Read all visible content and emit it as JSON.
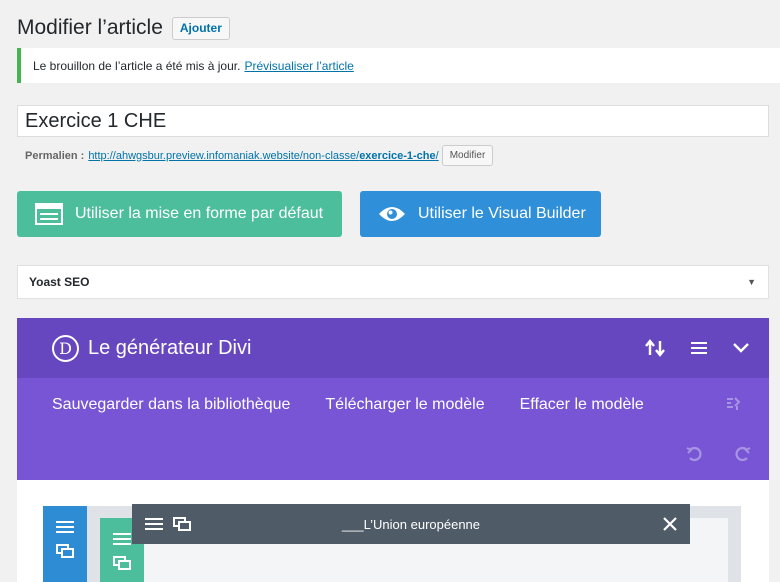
{
  "header": {
    "title": "Modifier l’article",
    "add_button": "Ajouter"
  },
  "notice": {
    "text": "Le brouillon de l’article a été mis à jour.",
    "link": "Prévisualiser l’article"
  },
  "post": {
    "title": "Exercice 1 CHE"
  },
  "permalink": {
    "label": "Permalien :",
    "url_prefix": "http://ahwgsbur.preview.infomaniak.website/non-classe/",
    "slug": "exercice-1-che",
    "url_suffix": "/",
    "edit_button": "Modifier"
  },
  "buttons": {
    "default_layout": "Utiliser la mise en forme par défaut",
    "visual_builder": "Utiliser le Visual Builder"
  },
  "yoast": {
    "title": "Yoast SEO"
  },
  "divi": {
    "logo": "D",
    "title": "Le générateur Divi",
    "actions": [
      "Sauvegarder dans la bibliothèque",
      "Télécharger le modèle",
      "Effacer le modèle"
    ],
    "module_title": "___L’Union européenne"
  },
  "colors": {
    "divi_header": "#6747c0",
    "divi_sub": "#7855d5",
    "green": "#4cbe9c",
    "blue": "#2f8fd8",
    "module": "#4f5b66"
  },
  "icons": [
    "layout-icon",
    "eye-icon",
    "sort-icon",
    "menu-icon",
    "chevron-down-icon",
    "portability-icon",
    "undo-icon",
    "redo-icon",
    "close-icon"
  ]
}
